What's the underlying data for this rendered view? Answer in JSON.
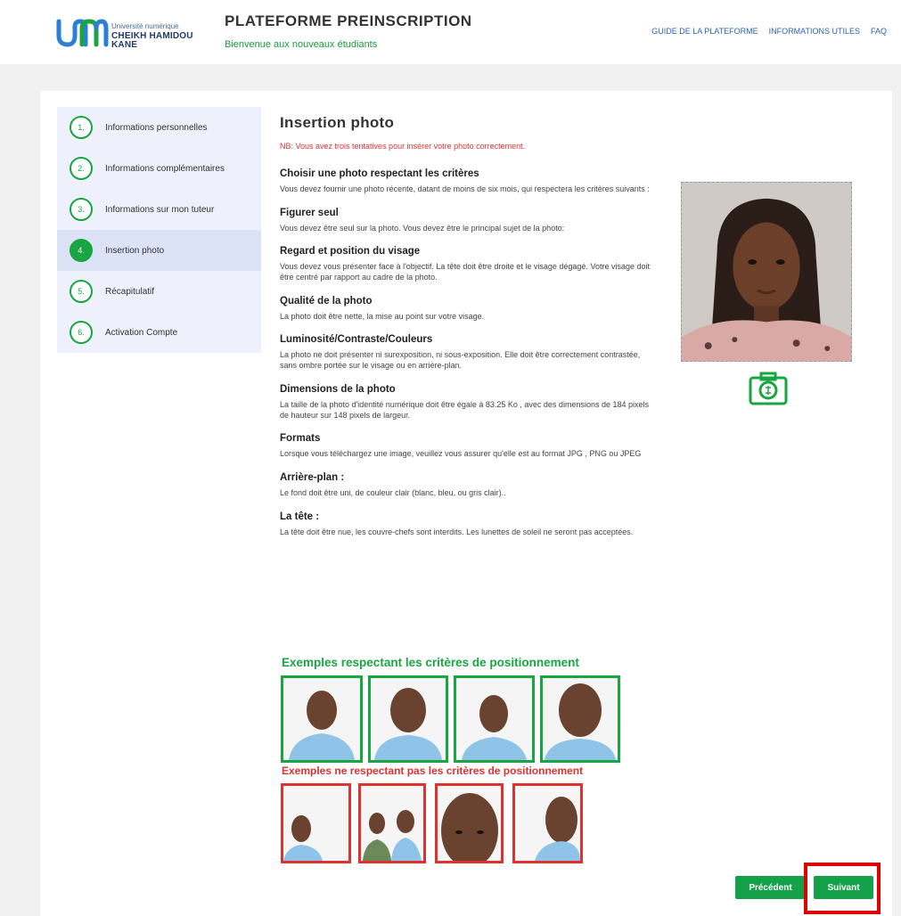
{
  "header": {
    "logo_small": "Université numérique",
    "logo_big": "CHEIKH HAMIDOU KANE",
    "title": "PLATEFORME PREINSCRIPTION",
    "subtitle": "Bienvenue aux nouveaux étudiants",
    "nav": [
      "GUIDE DE LA PLATEFORME",
      "INFORMATIONS UTILES",
      "FAQ"
    ]
  },
  "steps": [
    {
      "num": "1.",
      "label": "Informations personnelles",
      "active": false
    },
    {
      "num": "2.",
      "label": "Informations complémentaires",
      "active": false
    },
    {
      "num": "3.",
      "label": "Informations sur mon tuteur",
      "active": false
    },
    {
      "num": "4.",
      "label": "Insertion photo",
      "active": true
    },
    {
      "num": "5.",
      "label": "Récapitulatif",
      "active": false
    },
    {
      "num": "6.",
      "label": "Activation Compte",
      "active": false
    }
  ],
  "main": {
    "title": "Insertion photo",
    "note": "NB: Vous avez trois tentatives pour insérer votre photo correctement.",
    "sections": [
      {
        "title": "Choisir une photo respectant les critères",
        "body": "Vous devez fournir une photo récente, datant de moins de six mois, qui respectera les critères suivants :"
      },
      {
        "title": "Figurer seul",
        "body": "Vous devez être seul sur la photo. Vous devez être le principal sujet de la photo:"
      },
      {
        "title": "Regard et position du visage",
        "body": "Vous devez vous présenter face à l'objectif. La tête doit être droite et le visage dégagé. Votre visage doit être centré par rapport au cadre de la photo."
      },
      {
        "title": "Qualité de la photo",
        "body": "La photo doit être nette, la mise au point sur votre visage."
      },
      {
        "title": "Luminosité/Contraste/Couleurs",
        "body": "La photo ne doit présenter ni surexposition, ni sous-exposition. Elle doit être correctement contrastée, sans ombre portée sur le visage ou en arrière-plan."
      },
      {
        "title": "Dimensions de la photo",
        "body": "La taille de la photo d'identité numérique doit être égale à 83.25 Ko , avec des dimensions de 184 pixels de hauteur sur 148 pixels de largeur."
      },
      {
        "title": "Formats",
        "body": "Lorsque vous téléchargez une image, veuillez vous assurer qu'elle est au format JPG , PNG ou JPEG"
      },
      {
        "title": "Arrière-plan :",
        "body": "Le fond doit être uni, de couleur clair (blanc, bleu, ou gris clair).."
      },
      {
        "title": "La tête :",
        "body": "La tête doit être nue, les couvre-chefs sont interdits. Les lunettes de soleil ne seront pas acceptées."
      }
    ]
  },
  "examples": {
    "ok_title": "Exemples respectant les critères de positionnement",
    "bad_title": "Exemples ne respectant pas les critères de positionnement"
  },
  "buttons": {
    "prev": "Précédent",
    "next": "Suivant"
  },
  "colors": {
    "accent": "#1aa543",
    "error": "#e03131",
    "link": "#2962b8"
  }
}
